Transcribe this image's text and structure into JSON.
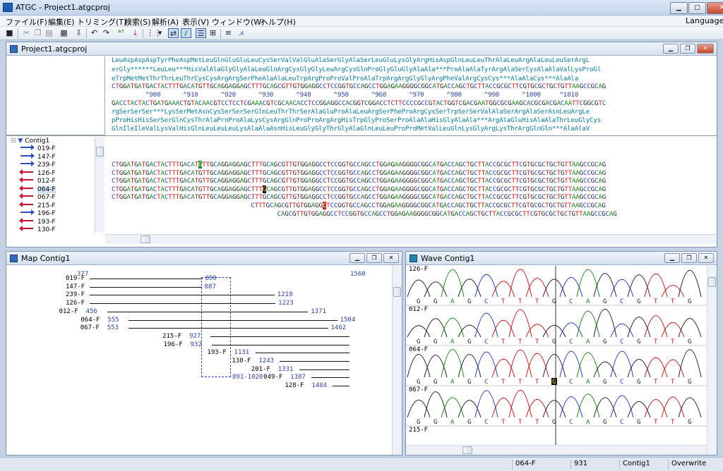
{
  "app": {
    "title": "ATGC - Project1.atgcproj",
    "language": "Language"
  },
  "menu": [
    "ファイル(F)",
    "編集(E)",
    "トリミング(T)",
    "検索(S)",
    "解析(A)",
    "表示(V)",
    "ウィンドウ(W)",
    "ヘルプ(H)"
  ],
  "toolbar_icons": [
    "save-icon",
    "cut-icon",
    "copy-icon",
    "paste-icon",
    "report-icon",
    "import-icon",
    "undo-icon",
    "redo-icon",
    "at-icon",
    "trim-icon",
    "palette-icon",
    "dropdown-icon",
    "swap-icon",
    "aligned-icon",
    "list-icon",
    "grid-icon",
    "filter-icon",
    "map-icon"
  ],
  "project_pane": {
    "title": "Project1.atgcproj"
  },
  "translation": [
    "LeuAspAspAspTyrPheAspMetLeuGlnGluGluLeuCysSerValValGluAlaSerGlyAlaSerLeuGluLysGlyArgHisAspGlnLeuLeuThrAlaLeuArgAlaLeuLeuSerArgL",
    "erGly******LeuLeu***HisValAlaGlyGlyAlaLeuGlnArgCysGlyGlyLeuArgCysGlnProGlyGluGlyAlaAla***ProAlaAlaTyrArgAlaSerCysAlaAlaValLysProGl",
    "eTrpMetMetThrThrLeuThrCysCysArgArgSerPheAlaAlaLeuTrpArgProProValProAlaTrpArgArgGlyGlyArgPheValArgCysCys***AlaAlaCys***AlaAla"
  ],
  "consensus": "CTGGATGATGACTACTTTGACATGTTGCAGGAGGAGCTTTGCAGCGTTGTGGAGGCCTCCGGTGCCAGCCTGGAGAAGGGGCGGCATGACCAGCTGCTTACCGCGCTTCGTGCGCTGCTGTTAAGCCGCAG",
  "ruler": "         ^900      ^910      ^920      ^930      ^940      ^950      ^960      ^970      ^980      ^990      ^1000     ^1010",
  "reverse_seq": "GACCTACTACTGATGAAACTGTACAACGTCCTCCTCGAAACGTCGCAACACCTCCGGAGGCCACGGTCGGACCTCTTCCCCGCCGTACTGGTCGACGAATGGCGCGAAGCACGCGACGACAATTCGGCGTC",
  "translation_rev": [
    "rgSerSerSer***LysSerMetAsnCysSerSerSerGlnLeuThrThrSerAlaGluProAlaLeuArgSerPheProArgCysSerTrpSerSerValAlaSerArgAlaSerAsnLeuArgLe",
    "pProHisHisSerSerGlnCysThrAlaProProAlaLysCysArgGlnProProArgArgHisTrpGlyProSerProAlaAlaHisGlyAlaAla***ArgAlaGluHisAlaAlaThrLeuGlyCys",
    "GlnIleIleValLysValHisGlnLeuLeuLeuLysAlaAlaAsnHisLeuGlyGlyThrGlyAlaGlnLeuLeuProProMetValLeuGlnLysGlyArgLysThrArgGlnGln***AlaAlaV"
  ],
  "tree": {
    "root": "Contig1",
    "items": [
      {
        "name": "019-F",
        "dir": "fwd"
      },
      {
        "name": "147-F",
        "dir": "fwd"
      },
      {
        "name": "239-F",
        "dir": "fwd"
      },
      {
        "name": "126-F",
        "dir": "rev"
      },
      {
        "name": "012-F",
        "dir": "rev"
      },
      {
        "name": "064-F",
        "dir": "rev",
        "selected": true
      },
      {
        "name": "067-F",
        "dir": "rev"
      },
      {
        "name": "215-F",
        "dir": "rev"
      },
      {
        "name": "196-F",
        "dir": "fwd"
      },
      {
        "name": "193-F",
        "dir": "rev"
      },
      {
        "name": "130-F",
        "dir": "rev"
      }
    ]
  },
  "alignment_rows": [
    {
      "pre": "CTGGATGATGACTACTTTGACAT",
      "hl": "G",
      "hlcolor": "green",
      "post": "TTGCAGGAGGAGCTTTGCAGCGTTGTGGAGGCCTCCGGTGCCAGCCTGGAGAAGGGGCGGCATGACCAGCTGCTTACCGCGCTTCGTGCGCTGCTGTTAAGCCGCAG",
      "indent": 0
    },
    {
      "pre": "CTGGATGATGACTACTTTGACATGTTGCAGGAGGAGCTTTGCAGCGTTGTGGAGGCCTCCGGTGCCAGCCTGGAGAAGGGGCGGCATGACCAGCTGCTTACCGCGCTTCGTGCGCTGCTGTTAAGCCGCAG",
      "hl": "",
      "hlcolor": "",
      "post": "",
      "indent": 0
    },
    {
      "pre": "CTGGATGATGACTACTTTGACATGTTGCAGGAGGAGCTTTGCAGCGTTGTGGAGGCCTCCGGTGCCAGCCTGGAGAAGGGGCGGCATGACCAGCTGCTTACCGCGCTTCGTGCGCTGCTGTTAAGCCGCAG",
      "hl": "",
      "hlcolor": "",
      "post": "",
      "indent": 0
    },
    {
      "pre": "CTGGATGATGACTACTTTGACATGTTGCAGGAGGAGCTTT",
      "hl": "G",
      "hlcolor": "black",
      "post": "CAGCGTTGTGGAGGCCTCCGGTGCCAGCCTGGAGAAGGGGCGGCATGACCAGCTGCTTACCGCGCTTCGTGCGCTGCTGTTAAGCCGCAG",
      "indent": 0
    },
    {
      "pre": "CTGGATGATGACTACTTTGACATGTTGCAGGAGGAGCTTTGCAGCGTTGTGGAGGCCTCCGGTGCCAGCCTGGAGAAGGGGCGGCATGACCAGCTGCTTACCGCGCTTCGTGCGCTGCTGTTAAGCCGCAG",
      "hl": "",
      "hlcolor": "",
      "post": "",
      "indent": 0
    },
    {
      "pre": "CTTTGCAGCGTTGTGGAGG",
      "hl": "C",
      "hlcolor": "red",
      "post": "TCCGGTGCCAGCCTGGAGAAGGGGCGGCATGACCAGCTGCTTACCGCGCTTCGTGCGCTGCTGTTAAGCCGCAG",
      "indent": 37
    },
    {
      "pre": "CAGCGTTGTGGAGGCCTCCGGTGCCAGCCTGGAGAAGGGGCGGCATGACCAGCTGCTTACCGCGCTTCGTGCGCTGCTGTTAAGCCGCAG",
      "hl": "",
      "hlcolor": "",
      "post": "",
      "indent": 44
    }
  ],
  "map_pane": {
    "title": "Map Contig1",
    "start": "377",
    "end": "1560",
    "window_label": "891-1020",
    "reads": [
      {
        "name": "019-F",
        "start": "",
        "end": "890"
      },
      {
        "name": "147-F",
        "start": "",
        "end": "887"
      },
      {
        "name": "239-F",
        "start": "",
        "end": "1219"
      },
      {
        "name": "126-F",
        "start": "",
        "end": "1223"
      },
      {
        "name": "012-F",
        "start": "456",
        "end": "1371"
      },
      {
        "name": "064-F",
        "start": "555",
        "end": "1504"
      },
      {
        "name": "067-F",
        "start": "553",
        "end": "1462"
      },
      {
        "name": "215-F",
        "start": "927",
        "end": ""
      },
      {
        "name": "196-F",
        "start": "932",
        "end": ""
      },
      {
        "name": "193-F",
        "start": "1131",
        "end": ""
      },
      {
        "name": "130-F",
        "start": "1243",
        "end": ""
      },
      {
        "name": "201-F",
        "start": "1331",
        "end": ""
      },
      {
        "name": "049-F",
        "start": "1387",
        "end": ""
      },
      {
        "name": "128-F",
        "start": "1484",
        "end": ""
      }
    ]
  },
  "wave_pane": {
    "title": "Wave Contig1",
    "traces": [
      {
        "name": "126-F",
        "bases": "G G A G C T T T G C A G C G T T G"
      },
      {
        "name": "012-F",
        "bases": "G G A G C T T T G C A G C G T T G"
      },
      {
        "name": "064-F",
        "bases": "G G A G C T T T G C A G C G T T G"
      },
      {
        "name": "067-F",
        "bases": "G G A G C T T T G C A G C G T T G"
      },
      {
        "name": "215-F",
        "bases": ""
      }
    ]
  },
  "status": {
    "read": "064-F",
    "position": "931",
    "contig": "Contig1",
    "mode": "Overwrite"
  },
  "colors": {
    "A": "#1a8a1a",
    "C": "#1f3fd1",
    "G": "#222222",
    "T": "#d01818",
    "aa": "#0a7ea0",
    "accent": "#2a52be"
  }
}
